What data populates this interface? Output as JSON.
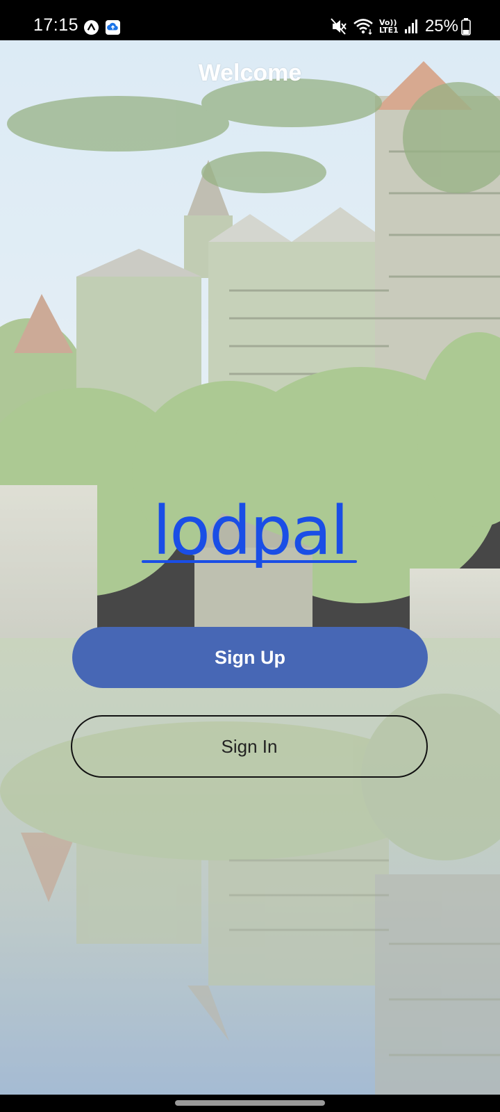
{
  "status_bar": {
    "time": "17:15",
    "battery": "25%",
    "network_label": "Vo)) LTE1",
    "notification_icons": [
      "a-circle-icon",
      "cloud-upload-icon"
    ],
    "right_icons": [
      "mute-icon",
      "wifi-icon",
      "signal-icon",
      "battery-icon"
    ]
  },
  "page": {
    "title": "Welcome",
    "logo_text": "lodpal"
  },
  "actions": {
    "sign_up_label": "Sign Up",
    "sign_in_label": "Sign In"
  },
  "colors": {
    "primary_button": "#4767b5",
    "logo": "#1a4ee6",
    "title_text": "#ffffff"
  }
}
